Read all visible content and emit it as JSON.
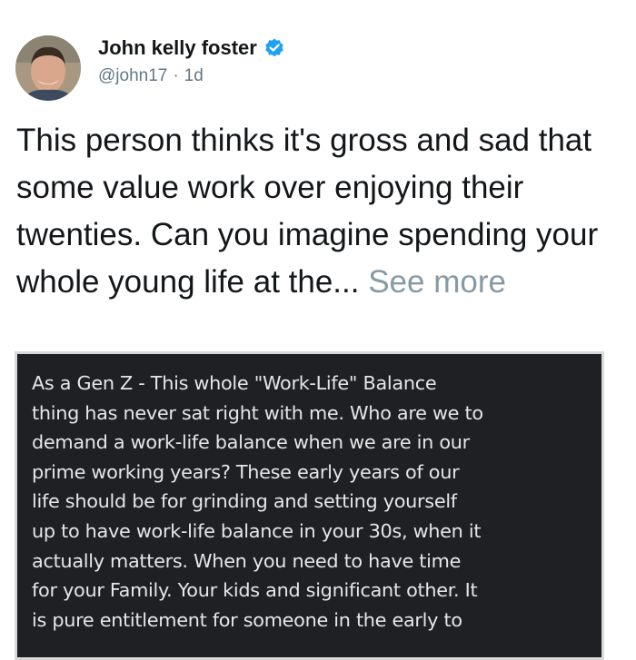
{
  "tweet": {
    "author_name": "John kelly foster",
    "handle": "@john17",
    "separator": "·",
    "time": "1d",
    "text": "This person thinks it's gross and sad that some value work over enjoying their twenties. Can you imagine spending your whole young life at the...",
    "see_more": "See more"
  },
  "screenshot_card": {
    "lines": [
      "As a Gen Z - This whole \"Work-Life\" Balance",
      "thing has never sat right with me. Who are we to",
      "demand a work-life balance when we are in our",
      "prime working years? These early years of our",
      "life should be for grinding and setting yourself",
      "up to have work-life balance in your 30s, when it",
      "actually matters. When you need to have time",
      "for your Family. Your kids and significant other. It",
      "is pure entitlement for someone in the early to"
    ]
  },
  "colors": {
    "verified_badge": "#1da1f2",
    "secondary_text": "#657786",
    "card_background": "#1f2024"
  },
  "icons": {
    "verified": "verified-badge-icon",
    "avatar": "avatar"
  }
}
